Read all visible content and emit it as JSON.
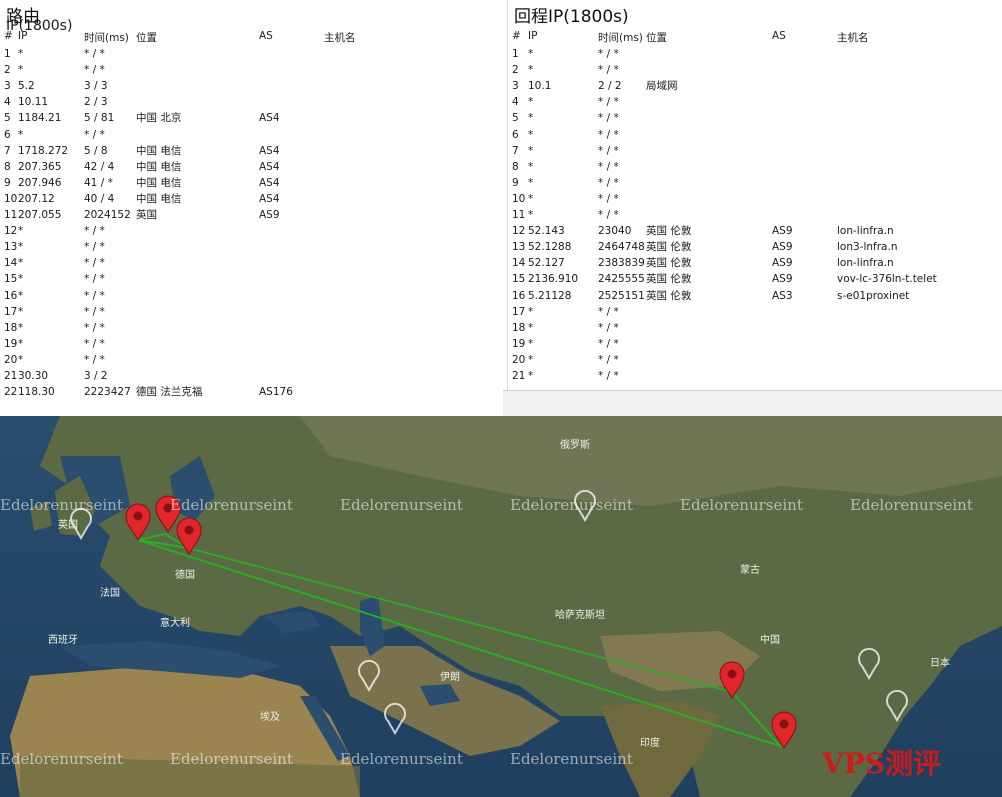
{
  "left": {
    "title_prefix": "路由",
    "title_ip": "",
    "title_sub": "IP(1800s)",
    "headers": [
      "#",
      "IP",
      "时间(ms)",
      "位置",
      "AS",
      "主机名"
    ],
    "rows": [
      {
        "n": "1",
        "ip": "*",
        "ms": "* / *",
        "loc": "",
        "as": "",
        "host": ""
      },
      {
        "n": "2",
        "ip": "*",
        "ms": "* / *",
        "loc": "",
        "as": "",
        "host": ""
      },
      {
        "n": "3",
        "ip": "5.2",
        "ms": "3 / 3",
        "loc": "",
        "as": "",
        "host": ""
      },
      {
        "n": "4",
        "ip": "10.11",
        "ms": "2 / 3",
        "loc": "",
        "as": "",
        "host": ""
      },
      {
        "n": "5",
        "ip": "1184.21",
        "ms": "5 / 81",
        "loc": "中国 北京",
        "as": "AS4",
        "host": ""
      },
      {
        "n": "6",
        "ip": "*",
        "ms": "* / *",
        "loc": "",
        "as": "",
        "host": ""
      },
      {
        "n": "7",
        "ip": "1718.272",
        "ms": "5 / 8",
        "loc": "中国 电信",
        "as": "AS4",
        "host": ""
      },
      {
        "n": "8",
        "ip": "207.365",
        "ms": "42 / 4",
        "loc": "中国 电信",
        "as": "AS4",
        "host": ""
      },
      {
        "n": "9",
        "ip": "207.946",
        "ms": "41 / *",
        "loc": "中国 电信",
        "as": "AS4",
        "host": ""
      },
      {
        "n": "10",
        "ip": "207.12",
        "ms": "40 / 4",
        "loc": "中国 电信",
        "as": "AS4",
        "host": ""
      },
      {
        "n": "11",
        "ip": "207.055",
        "ms": "2024152",
        "loc": "英国",
        "as": "AS9",
        "host": ""
      },
      {
        "n": "12",
        "ip": "*",
        "ms": "* / *",
        "loc": "",
        "as": "",
        "host": ""
      },
      {
        "n": "13",
        "ip": "*",
        "ms": "* / *",
        "loc": "",
        "as": "",
        "host": ""
      },
      {
        "n": "14",
        "ip": "*",
        "ms": "* / *",
        "loc": "",
        "as": "",
        "host": ""
      },
      {
        "n": "15",
        "ip": "*",
        "ms": "* / *",
        "loc": "",
        "as": "",
        "host": ""
      },
      {
        "n": "16",
        "ip": "*",
        "ms": "* / *",
        "loc": "",
        "as": "",
        "host": ""
      },
      {
        "n": "17",
        "ip": "*",
        "ms": "* / *",
        "loc": "",
        "as": "",
        "host": ""
      },
      {
        "n": "18",
        "ip": "*",
        "ms": "* / *",
        "loc": "",
        "as": "",
        "host": ""
      },
      {
        "n": "19",
        "ip": "*",
        "ms": "* / *",
        "loc": "",
        "as": "",
        "host": ""
      },
      {
        "n": "20",
        "ip": "*",
        "ms": "* / *",
        "loc": "",
        "as": "",
        "host": ""
      },
      {
        "n": "21",
        "ip": "30.30",
        "ms": "3 / 2",
        "loc": "",
        "as": "",
        "host": ""
      },
      {
        "n": "22",
        "ip": "118.30",
        "ms": "2223427",
        "loc": "德国 法兰克福",
        "as": "AS176",
        "host": ""
      }
    ]
  },
  "right": {
    "title": "回程IP(1800s)",
    "headers": [
      "#",
      "IP",
      "时间(ms)",
      "位置",
      "AS",
      "主机名"
    ],
    "rows": [
      {
        "n": "1",
        "ip": "*",
        "ms": "* / *",
        "loc": "",
        "as": "",
        "host": ""
      },
      {
        "n": "2",
        "ip": "*",
        "ms": "* / *",
        "loc": "",
        "as": "",
        "host": ""
      },
      {
        "n": "3",
        "ip": "10.1",
        "ms": "2 / 2",
        "loc": "局域网",
        "as": "",
        "host": ""
      },
      {
        "n": "4",
        "ip": "*",
        "ms": "* / *",
        "loc": "",
        "as": "",
        "host": ""
      },
      {
        "n": "5",
        "ip": "*",
        "ms": "* / *",
        "loc": "",
        "as": "",
        "host": ""
      },
      {
        "n": "6",
        "ip": "*",
        "ms": "* / *",
        "loc": "",
        "as": "",
        "host": ""
      },
      {
        "n": "7",
        "ip": "*",
        "ms": "* / *",
        "loc": "",
        "as": "",
        "host": ""
      },
      {
        "n": "8",
        "ip": "*",
        "ms": "* / *",
        "loc": "",
        "as": "",
        "host": ""
      },
      {
        "n": "9",
        "ip": "*",
        "ms": "* / *",
        "loc": "",
        "as": "",
        "host": ""
      },
      {
        "n": "10",
        "ip": "*",
        "ms": "* / *",
        "loc": "",
        "as": "",
        "host": ""
      },
      {
        "n": "11",
        "ip": "*",
        "ms": "* / *",
        "loc": "",
        "as": "",
        "host": ""
      },
      {
        "n": "12",
        "ip": "52.143",
        "ms": "23040",
        "loc": "英国 伦敦",
        "as": "AS9",
        "host": "lon-linfra.n"
      },
      {
        "n": "13",
        "ip": "52.1288",
        "ms": "2464748",
        "loc": "英国 伦敦",
        "as": "AS9",
        "host": "lon3-lnfra.n"
      },
      {
        "n": "14",
        "ip": "52.127",
        "ms": "2383839",
        "loc": "英国 伦敦",
        "as": "AS9",
        "host": "lon-linfra.n"
      },
      {
        "n": "15",
        "ip": "2136.910",
        "ms": "2425555",
        "loc": "英国 伦敦",
        "as": "AS9",
        "host": "vov-lc-376ln-t.telet"
      },
      {
        "n": "16",
        "ip": "5.21128",
        "ms": "2525151",
        "loc": "英国 伦敦",
        "as": "AS3",
        "host": "s-e01proxinet"
      },
      {
        "n": "17",
        "ip": "*",
        "ms": "* / *",
        "loc": "",
        "as": "",
        "host": ""
      },
      {
        "n": "18",
        "ip": "*",
        "ms": "* / *",
        "loc": "",
        "as": "",
        "host": ""
      },
      {
        "n": "19",
        "ip": "*",
        "ms": "* / *",
        "loc": "",
        "as": "",
        "host": ""
      },
      {
        "n": "20",
        "ip": "*",
        "ms": "* / *",
        "loc": "",
        "as": "",
        "host": ""
      },
      {
        "n": "21",
        "ip": "*",
        "ms": "* / *",
        "loc": "",
        "as": "",
        "host": ""
      }
    ]
  },
  "map": {
    "labels": {
      "china": "中国",
      "india": "印度",
      "mongolia": "蒙古",
      "kazakhstan": "哈萨克斯坦",
      "france": "法国",
      "germany": "德国",
      "spain": "西班牙",
      "italy": "意大利",
      "uk": "英国",
      "iran": "伊朗",
      "egypt": "埃及",
      "japan": "日本",
      "russia": "俄罗斯"
    },
    "watermark": "Edelorenurseint",
    "brand": "VPS测评"
  }
}
